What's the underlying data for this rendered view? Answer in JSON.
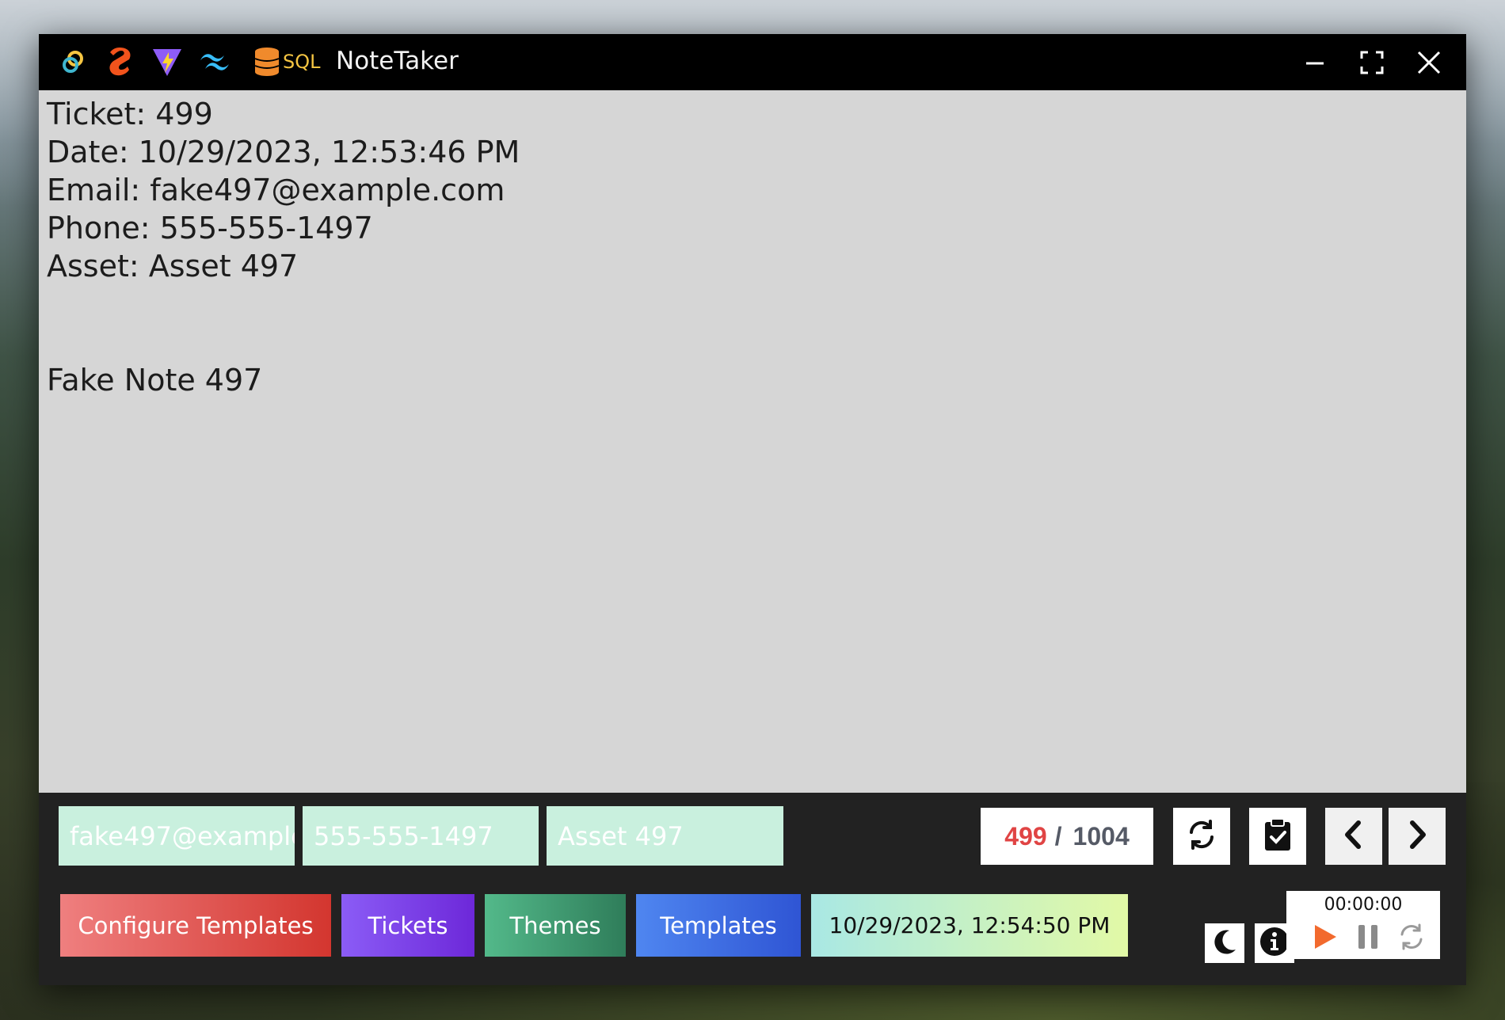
{
  "window": {
    "title": "NoteTaker",
    "title_icons": [
      "tauri-icon",
      "svelte-icon",
      "vite-icon",
      "tailwind-icon",
      "sql-icon"
    ],
    "sql_label": "SQL",
    "controls": [
      "minimize-icon",
      "maximize-icon",
      "close-icon"
    ]
  },
  "note": {
    "lines": [
      "Ticket: 499",
      "Date: 10/29/2023, 12:53:46 PM",
      "Email: fake497@example.com",
      "Phone: 555-555-1497",
      "Asset: Asset 497"
    ],
    "body": "Fake Note 497"
  },
  "fields": {
    "email": "fake497@example.com",
    "phone": "555-555-1497",
    "asset": "Asset 497"
  },
  "counter": {
    "current": "499",
    "separator": "/",
    "total": "1004"
  },
  "toolbar_icons": [
    "refresh-icon",
    "clipboard-check-icon",
    "chevron-left-icon",
    "chevron-right-icon"
  ],
  "buttons": {
    "configure_templates": "Configure Templates",
    "tickets": "Tickets",
    "themes": "Themes",
    "templates": "Templates"
  },
  "datetime": "10/29/2023, 12:54:50 PM",
  "timer": {
    "elapsed": "00:00:00",
    "controls": [
      "play-icon",
      "pause-icon",
      "reset-icon"
    ]
  },
  "colors": {
    "configure_templates": [
      "#ef7f7f",
      "#d3362f"
    ],
    "tickets": [
      "#8b5cf6",
      "#6d28d9"
    ],
    "themes": [
      "#53b98a",
      "#2f7d5a"
    ],
    "templates": [
      "#4f86f0",
      "#2f55d4"
    ],
    "field_bg": "#c9f0de",
    "counter_current": "#e04444",
    "play": "#f26a2e"
  }
}
